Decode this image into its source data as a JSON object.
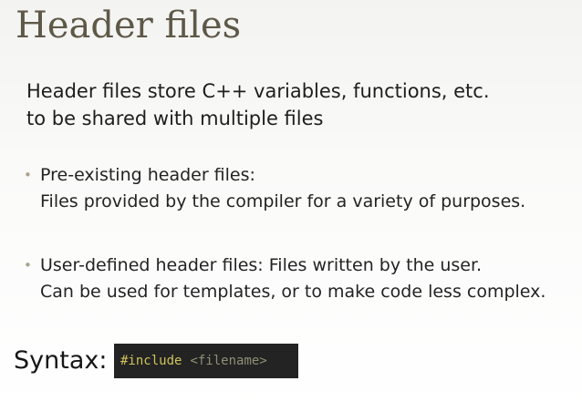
{
  "slide": {
    "title": "Header files",
    "intro_lines": [
      "Header files store C++ variables, functions, etc.",
      "to be shared with multiple files"
    ],
    "bullets": [
      {
        "marker": "•",
        "lines": [
          "Pre-existing header files:",
          "Files provided by the compiler for a variety of purposes."
        ]
      },
      {
        "marker": "•",
        "lines": [
          "User-defined header files: Files written by the user.",
          "Can be used for templates, or to make code less complex."
        ]
      }
    ],
    "syntax": {
      "label": "Syntax:",
      "code_keyword": "#include",
      "code_argument": "<filename>"
    }
  },
  "colors": {
    "title": "#5e5848",
    "bullet_marker": "#a9a489",
    "code_background": "#232323",
    "code_keyword": "#cfc25a",
    "code_argument": "#8f8f76"
  }
}
